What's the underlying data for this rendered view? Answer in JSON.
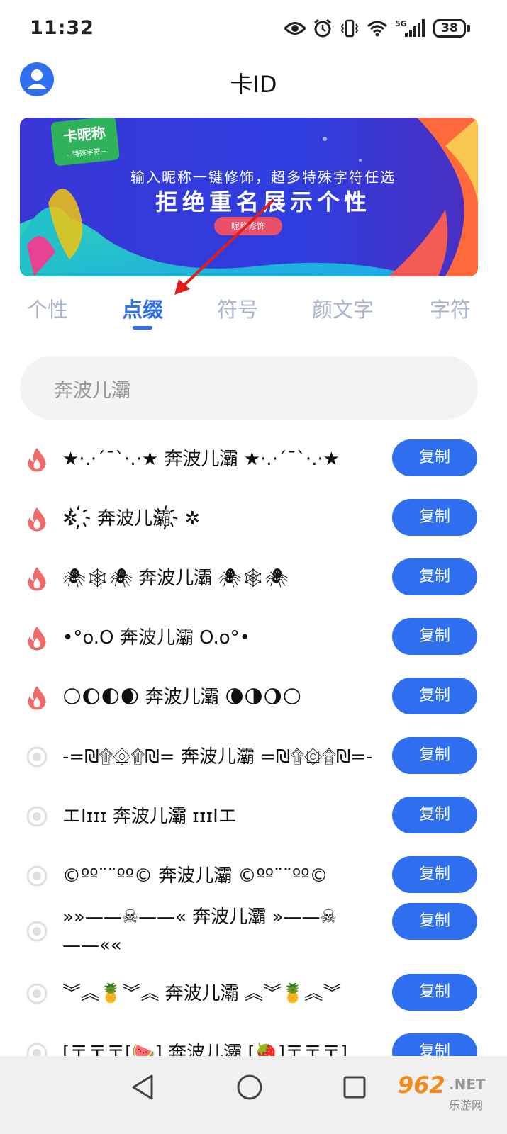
{
  "status_bar": {
    "time": "11:32",
    "network": "5G",
    "battery": "38"
  },
  "header": {
    "title": "卡ID"
  },
  "banner": {
    "brand_name": "卡昵称",
    "brand_sub": "--特殊字符--",
    "line1": "输入昵称一键修饰，超多特殊字符任选",
    "line2": "拒绝重名展示个性",
    "button": "昵称修饰"
  },
  "tabs": [
    {
      "label": "个性",
      "active": false
    },
    {
      "label": "点缀",
      "active": true
    },
    {
      "label": "符号",
      "active": false
    },
    {
      "label": "颜文字",
      "active": false
    },
    {
      "label": "字符",
      "active": false
    }
  ],
  "search": {
    "value": "奔波儿灞"
  },
  "copy_label": "复制",
  "items": [
    {
      "text": "★·.·´¯`·.·★ 奔波儿灞 ★·.·´¯`·.·★",
      "hot": true
    },
    {
      "text": "✲ ҉ 奔波儿灞҉ ✲",
      "hot": true
    },
    {
      "text": "🕷🕸🕷 奔波儿灞 🕷🕸🕷",
      "hot": true
    },
    {
      "text": "•°o.O 奔波儿灞 O.o°•",
      "hot": true
    },
    {
      "text": "🌕🌔🌓🌒 奔波儿灞 🌘🌗🌖🌕",
      "hot": true
    },
    {
      "text": "-=₪۩۞۩₪= 奔波儿灞 =₪۩۞۩₪=-",
      "hot": false
    },
    {
      "text": "エIɪɪɪ 奔波儿灞 ɪɪɪIエ",
      "hot": false
    },
    {
      "text": "©ºº¨¨ºº© 奔波儿灞 ©ºº¨¨ºº©",
      "hot": false
    },
    {
      "text": "»»——☠——« 奔波儿灞 »——☠——««",
      "hot": false
    },
    {
      "text": "︾︽🍍︾︽ 奔波儿灞 ︽︾🍍︽︾",
      "hot": false
    },
    {
      "text": "[〒〒〒[🍉] 奔波儿灞 [🍓]〒〒〒]",
      "hot": false
    }
  ],
  "watermark": {
    "brand": "962",
    "suffix": ".NET",
    "sub": "乐游网"
  },
  "colors": {
    "accent": "#2f6fef",
    "hot": "#f06a6a",
    "inactive_tab": "#aab4cf"
  }
}
